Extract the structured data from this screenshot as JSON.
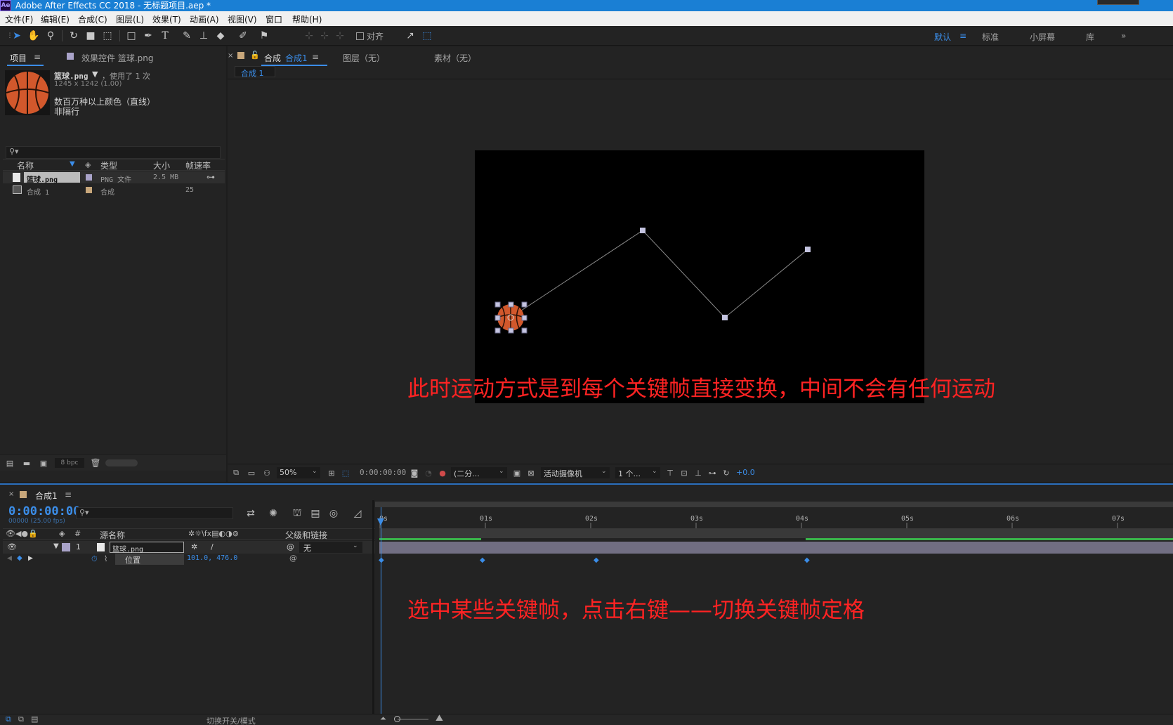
{
  "app": {
    "window_title": "Adobe After Effects CC 2018 - 无标题项目.aep *",
    "logo": "Ae"
  },
  "menu": [
    "文件(F)",
    "编辑(E)",
    "合成(C)",
    "图层(L)",
    "效果(T)",
    "动画(A)",
    "视图(V)",
    "窗口",
    "帮助(H)"
  ],
  "toolbar": {
    "align_label": "对齐",
    "workspaces": [
      "默认",
      "标准",
      "小屏幕",
      "库"
    ]
  },
  "project": {
    "tab_project": "项目",
    "tab_effects": "效果控件 篮球.png",
    "asset_name": "篮球.png",
    "asset_used": "，使用了 1 次",
    "asset_dims": "1245 x 1242 (1.00)",
    "asset_colors": "数百万种以上颜色（直线）",
    "asset_interlace": "非隔行",
    "columns": [
      "名称",
      "类型",
      "大小",
      "帧速率"
    ],
    "items": [
      {
        "name": "篮球.png",
        "type": "PNG 文件",
        "size": "2.5 MB",
        "fps": ""
      },
      {
        "name": "合成 1",
        "type": "合成",
        "size": "",
        "fps": "25"
      }
    ],
    "bpc": "8 bpc"
  },
  "viewer": {
    "tab_comp_prefix": "合成",
    "tab_comp_name": "合成1",
    "tab_layer": "图层（无）",
    "tab_footage": "素材（无）",
    "breadcrumb": "合成 1",
    "zoom": "50%",
    "timecode": "0:00:00:00",
    "resolution": "(二分...",
    "camera": "活动摄像机",
    "views": "1 个...",
    "exposure": "+0.0"
  },
  "annotations": {
    "viewer_note": "此时运动方式是到每个关键帧直接变换，中间不会有任何运动",
    "timeline_note": "选中某些关键帧，点击右键——切换关键帧定格"
  },
  "timeline": {
    "tab_name": "合成1",
    "current_time": "0:00:00:00",
    "frame_info": "00000 (25.00 fps)",
    "col_source_name": "源名称",
    "col_parent": "父级和链接",
    "layer_index": "1",
    "layer_name": "篮球.png",
    "parent_value": "无",
    "property_name": "位置",
    "property_value": "101.0, 476.0",
    "ruler_labels": [
      "0s",
      "01s",
      "02s",
      "03s",
      "04s",
      "05s",
      "06s",
      "07s"
    ],
    "footer_toggle": "切换开关/模式"
  },
  "colors": {
    "accent": "#3b8de8",
    "annotation": "#ff2323",
    "layer_bar": "#9b97b5",
    "work_area": "#39b54a"
  }
}
